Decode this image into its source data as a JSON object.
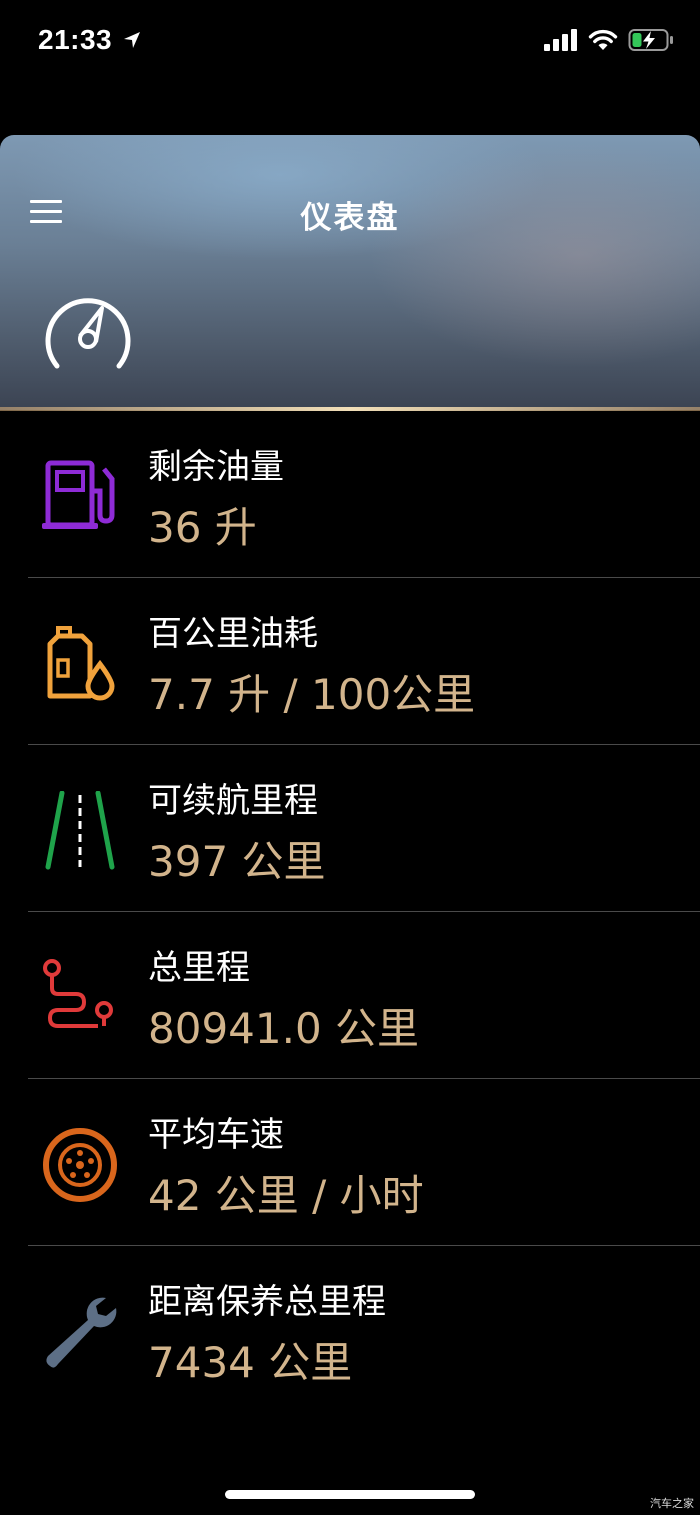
{
  "status_bar": {
    "time": "21:33",
    "location_icon": "location-arrow-icon",
    "signal_icon": "cellular-signal-icon",
    "wifi_icon": "wifi-icon",
    "battery_icon": "battery-charging-icon",
    "battery_color": "#34c759"
  },
  "header": {
    "title": "仪表盘",
    "menu_icon": "hamburger-menu-icon",
    "dashboard_icon": "speedometer-icon"
  },
  "metrics": [
    {
      "label": "剩余油量",
      "value": "36 升",
      "icon": "fuel-pump-icon",
      "icon_color": "#8e2bd6"
    },
    {
      "label": "百公里油耗",
      "value": "7.7 升 / 100公里",
      "icon": "oil-can-drop-icon",
      "icon_color": "#f0a23c"
    },
    {
      "label": "可续航里程",
      "value": "397 公里",
      "icon": "road-lanes-icon",
      "icon_color": "#1fa34a"
    },
    {
      "label": "总里程",
      "value": "80941.0 公里",
      "icon": "route-path-icon",
      "icon_color": "#e03a3a"
    },
    {
      "label": "平均车速",
      "value": "42 公里 / 小时",
      "icon": "wheel-icon",
      "icon_color": "#d9661c"
    },
    {
      "label": "距离保养总里程",
      "value": "7434 公里",
      "icon": "wrench-icon",
      "icon_color": "#5d6f86"
    }
  ],
  "value_color": "#d2b48c",
  "watermark": "汽车之家"
}
